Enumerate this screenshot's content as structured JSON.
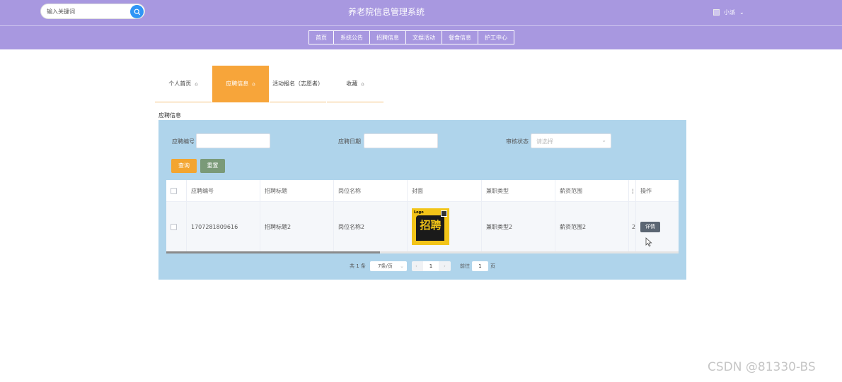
{
  "header": {
    "search_placeholder": "输入关键词",
    "title": "养老院信息管理系统",
    "username": "小派",
    "dropdown_caret": "⌄",
    "bg_color": "#a898e0"
  },
  "nav": {
    "items": [
      "首页",
      "系统公告",
      "招聘信息",
      "文娱活动",
      "餐食信息",
      "护工中心"
    ]
  },
  "tabs": {
    "items": [
      {
        "label": "个人首页",
        "active": false
      },
      {
        "label": "应聘信息",
        "active": true
      },
      {
        "label": "活动报名（志愿者）",
        "active": false
      },
      {
        "label": "收藏",
        "active": false
      }
    ],
    "active_color": "#f7a53a"
  },
  "section": {
    "title": "应聘信息"
  },
  "filters": {
    "apply_no_label": "应聘编号",
    "apply_date_label": "应聘日期",
    "status_label": "审核状态",
    "status_placeholder": "请选择",
    "query_button": "查询",
    "reset_button": "重置"
  },
  "table": {
    "headers": [
      "应聘编号",
      "招聘标题",
      "岗位名称",
      "封面",
      "兼职类型",
      "薪资范围",
      "操作"
    ],
    "rows": [
      {
        "apply_no": "1707281809616",
        "recruit_title": "招聘标题2",
        "position": "岗位名称2",
        "cover_text": "招聘",
        "cover_logo": "Logo",
        "job_type": "兼职类型2",
        "salary": "薪资范围2",
        "hidden_col_prefix": "2",
        "action": "详情"
      }
    ]
  },
  "pagination": {
    "total": "共 1 条",
    "page_size": "7条/页",
    "current_page": "1",
    "goto_label": "前往",
    "goto_value": "1",
    "page_unit": "页"
  },
  "watermark": "CSDN @81330-BS"
}
